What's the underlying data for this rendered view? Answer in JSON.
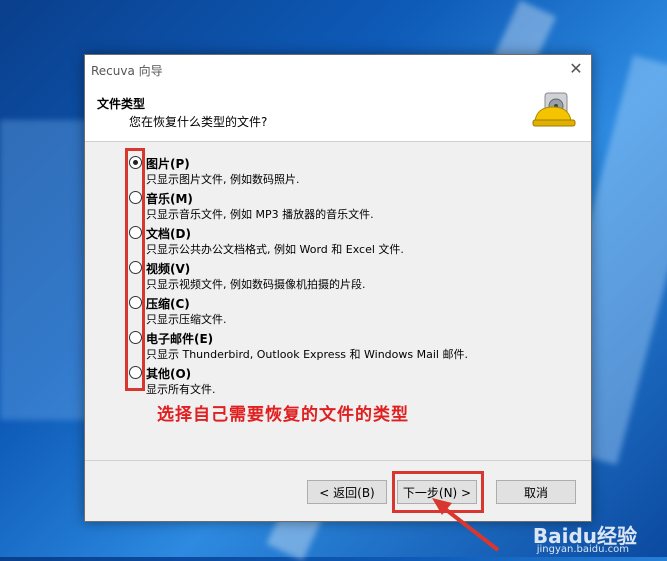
{
  "window": {
    "title": "Recuva 向导"
  },
  "header": {
    "title": "文件类型",
    "subtitle": "您在恢复什么类型的文件?"
  },
  "options": [
    {
      "label": "图片(P)",
      "desc": "只显示图片文件, 例如数码照片.",
      "checked": true
    },
    {
      "label": "音乐(M)",
      "desc": "只显示音乐文件, 例如 MP3 播放器的音乐文件.",
      "checked": false
    },
    {
      "label": "文档(D)",
      "desc": "只显示公共办公文档格式, 例如 Word 和 Excel 文件.",
      "checked": false
    },
    {
      "label": "视频(V)",
      "desc": "只显示视频文件, 例如数码摄像机拍摄的片段.",
      "checked": false
    },
    {
      "label": "压缩(C)",
      "desc": "只显示压缩文件.",
      "checked": false
    },
    {
      "label": "电子邮件(E)",
      "desc": "只显示 Thunderbird, Outlook Express 和 Windows Mail 邮件.",
      "checked": false
    },
    {
      "label": "其他(O)",
      "desc": "显示所有文件.",
      "checked": false
    }
  ],
  "annotation": {
    "text": "选择自己需要恢复的文件的类型",
    "color": "#e02020"
  },
  "buttons": {
    "back": "< 返回(B)",
    "next": "下一步(N) >",
    "cancel": "取消"
  },
  "watermark": {
    "brand": "Baidu经验",
    "url": "jingyan.baidu.com"
  }
}
